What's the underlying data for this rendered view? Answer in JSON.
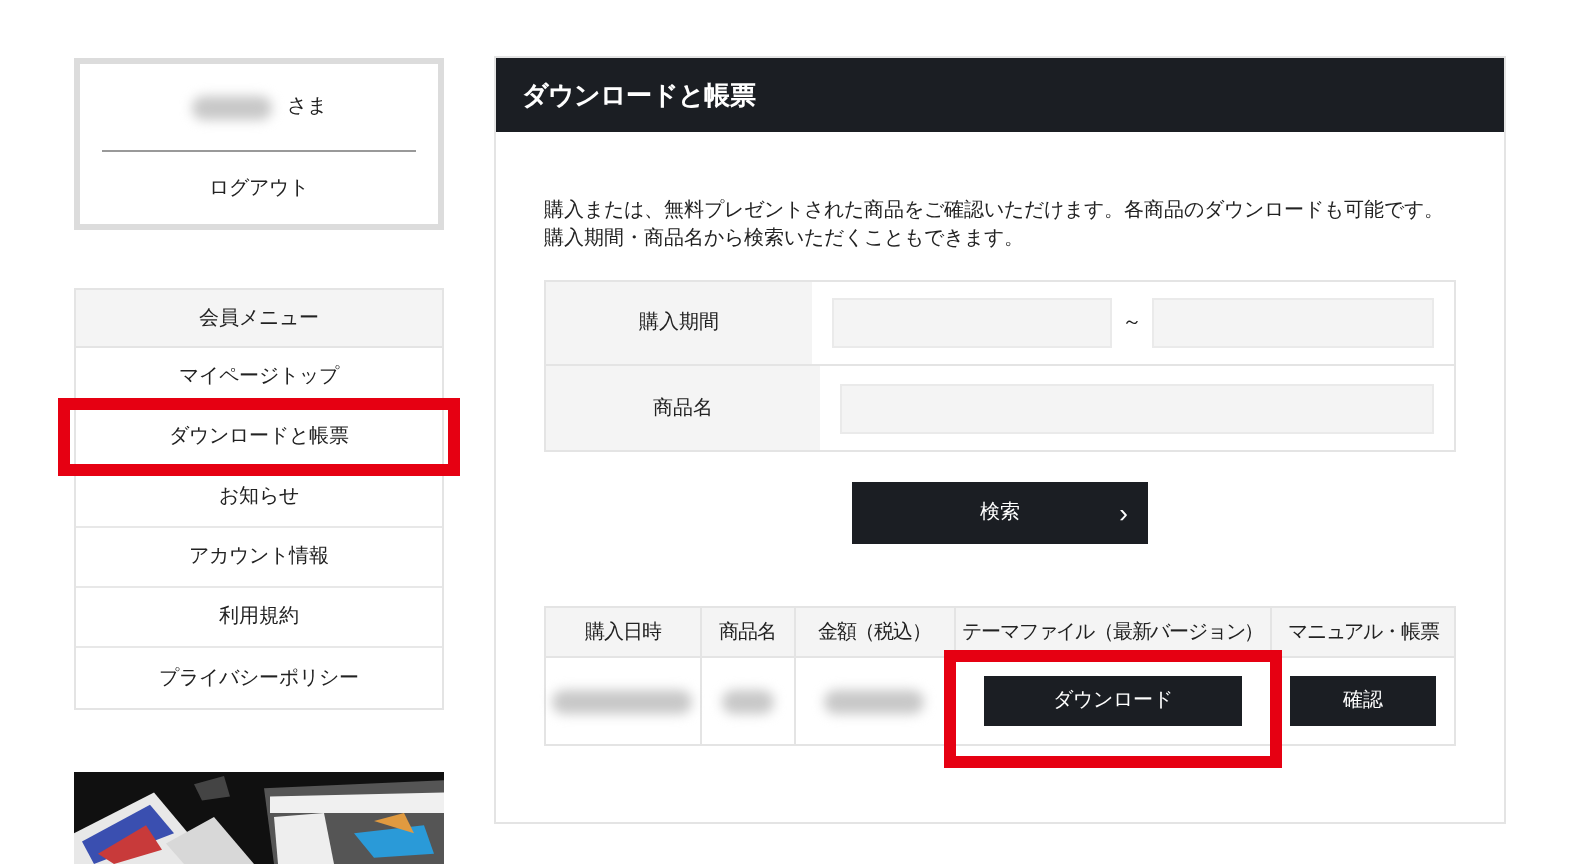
{
  "user_box": {
    "honorific": "さま",
    "logout": "ログアウト"
  },
  "member_menu": {
    "heading": "会員メニュー",
    "items": [
      {
        "label": "マイページトップ",
        "highlighted": false
      },
      {
        "label": "ダウンロードと帳票",
        "highlighted": true
      },
      {
        "label": "お知らせ",
        "highlighted": false
      },
      {
        "label": "アカウント情報",
        "highlighted": false
      },
      {
        "label": "利用規約",
        "highlighted": false
      },
      {
        "label": "プライバシーポリシー",
        "highlighted": false
      }
    ]
  },
  "main": {
    "title": "ダウンロードと帳票",
    "intro": [
      "購入または、無料プレゼントされた商品をご確認いただけます。各商品のダウンロードも可能です。",
      "購入期間・商品名から検索いただくこともできます。"
    ],
    "search_form": {
      "period_label": "購入期間",
      "range_separator": "～",
      "product_label": "商品名",
      "search_button": "検索",
      "search_arrow": "›"
    },
    "table": {
      "columns": [
        {
          "label": "購入日時"
        },
        {
          "label": "商品名"
        },
        {
          "label": "金額",
          "note": "（税込）"
        },
        {
          "label": "テーマファイル",
          "note": "（最新バージョン）"
        },
        {
          "label": "マニュアル・帳票"
        }
      ],
      "rows": [
        {
          "download_button": "ダウンロード",
          "download_highlighted": true,
          "confirm_button": "確認"
        }
      ]
    }
  }
}
